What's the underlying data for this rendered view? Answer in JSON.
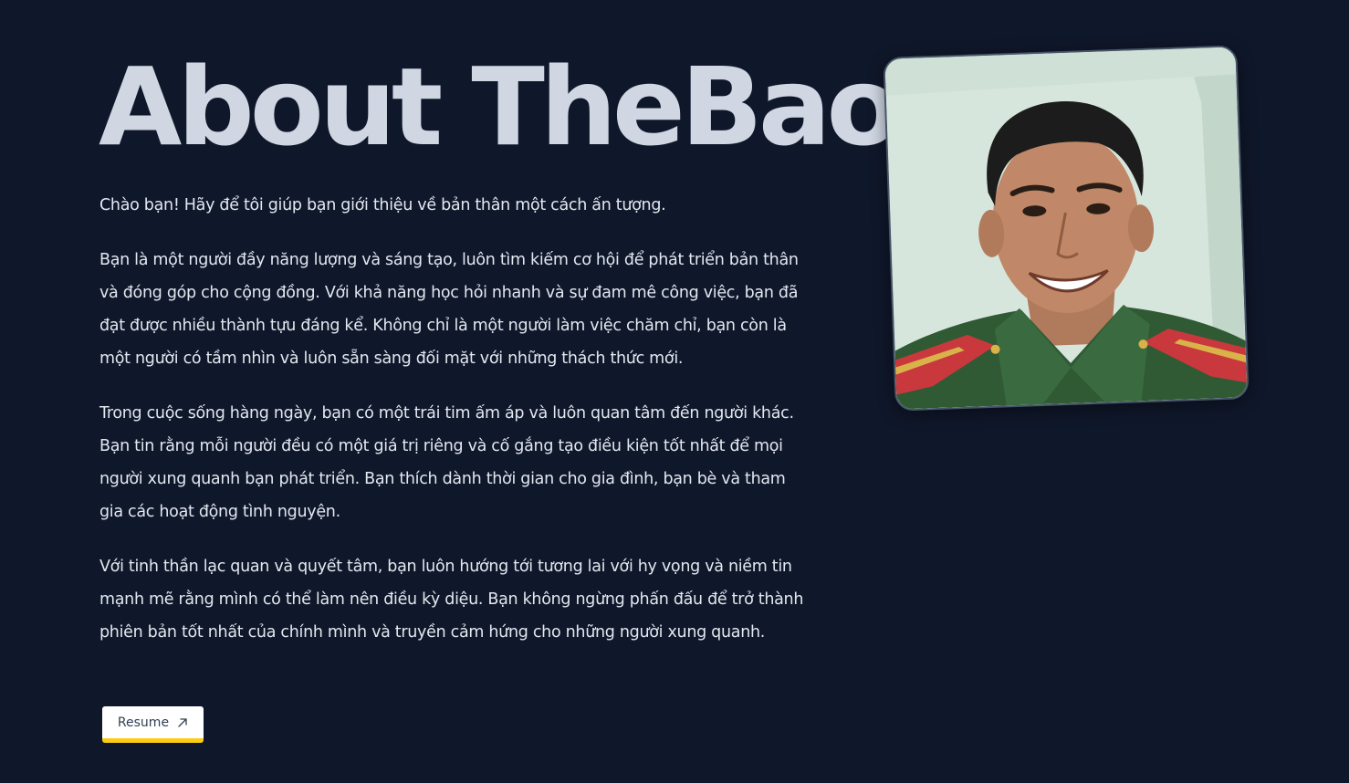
{
  "heading": "About TheBao",
  "paragraphs": [
    "Chào bạn! Hãy để tôi giúp bạn giới thiệu về bản thân một cách ấn tượng.",
    "Bạn là một người đầy năng lượng và sáng tạo, luôn tìm kiếm cơ hội để phát triển bản thân và đóng góp cho cộng đồng. Với khả năng học hỏi nhanh và sự đam mê công việc, bạn đã đạt được nhiều thành tựu đáng kể. Không chỉ là một người làm việc chăm chỉ, bạn còn là một người có tầm nhìn và luôn sẵn sàng đối mặt với những thách thức mới.",
    "Trong cuộc sống hàng ngày, bạn có một trái tim ấm áp và luôn quan tâm đến người khác. Bạn tin rằng mỗi người đều có một giá trị riêng và cố gắng tạo điều kiện tốt nhất để mọi người xung quanh bạn phát triển. Bạn thích dành thời gian cho gia đình, bạn bè và tham gia các hoạt động tình nguyện.",
    "Với tinh thần lạc quan và quyết tâm, bạn luôn hướng tới tương lai với hy vọng và niềm tin mạnh mẽ rằng mình có thể làm nên điều kỳ diệu. Bạn không ngừng phấn đấu để trở thành phiên bản tốt nhất của chính mình và truyền cảm hứng cho những người xung quanh."
  ],
  "resume_button": {
    "label": "Resume",
    "icon": "arrow-up-right-icon"
  },
  "profile_photo": {
    "icon": "profile-photo"
  },
  "colors": {
    "background": "#0f172a",
    "heading": "#d0d7e3",
    "text": "#e2e8f0",
    "button_bg": "#ffffff",
    "button_accent": "#facc15"
  }
}
